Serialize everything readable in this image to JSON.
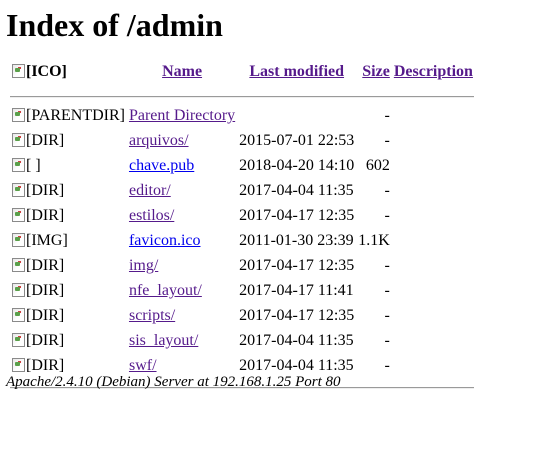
{
  "page": {
    "heading": "Index of /admin"
  },
  "table": {
    "headers": {
      "icon_alt": "[ICO]",
      "name": "Name",
      "last_modified": "Last modified",
      "size": "Size",
      "description": "Description"
    },
    "rows": [
      {
        "icon_alt": "[PARENTDIR]",
        "name": "Parent Directory",
        "modified": "",
        "size": "-",
        "description": ""
      },
      {
        "icon_alt": "[DIR]",
        "name": "arquivos/",
        "modified": "2015-07-01 22:53",
        "size": "-",
        "description": ""
      },
      {
        "icon_alt": "[ ]",
        "name": "chave.pub",
        "modified": "2018-04-20 14:10",
        "size": "602",
        "description": ""
      },
      {
        "icon_alt": "[DIR]",
        "name": "editor/",
        "modified": "2017-04-04 11:35",
        "size": "-",
        "description": ""
      },
      {
        "icon_alt": "[DIR]",
        "name": "estilos/",
        "modified": "2017-04-17 12:35",
        "size": "-",
        "description": ""
      },
      {
        "icon_alt": "[IMG]",
        "name": "favicon.ico",
        "modified": "2011-01-30 23:39",
        "size": "1.1K",
        "description": ""
      },
      {
        "icon_alt": "[DIR]",
        "name": "img/",
        "modified": "2017-04-17 12:35",
        "size": "-",
        "description": ""
      },
      {
        "icon_alt": "[DIR]",
        "name": "nfe_layout/",
        "modified": "2017-04-17 11:41",
        "size": "-",
        "description": ""
      },
      {
        "icon_alt": "[DIR]",
        "name": "scripts/",
        "modified": "2017-04-17 12:35",
        "size": "-",
        "description": ""
      },
      {
        "icon_alt": "[DIR]",
        "name": "sis_layout/",
        "modified": "2017-04-04 11:35",
        "size": "-",
        "description": ""
      },
      {
        "icon_alt": "[DIR]",
        "name": "swf/",
        "modified": "2017-04-04 11:35",
        "size": "-",
        "description": ""
      }
    ]
  },
  "footer": {
    "address": "Apache/2.4.10 (Debian) Server at 192.168.1.25 Port 80"
  },
  "colors": {
    "visited_link": "#551a8b",
    "link": "#0000ee",
    "text": "#000000",
    "background": "#ffffff"
  }
}
